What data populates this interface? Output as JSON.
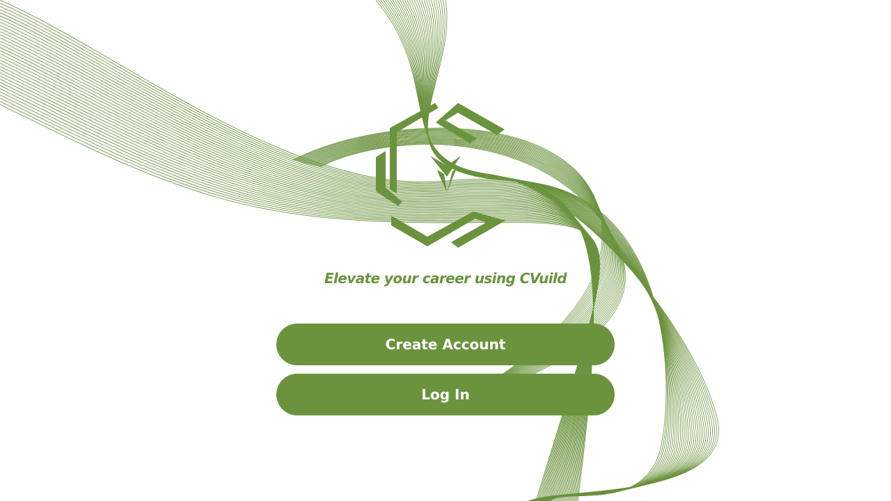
{
  "brand": {
    "name": "CVuild",
    "logo_text": "CVuild",
    "accent_color": "#6b933e",
    "line_color": "#6b933e"
  },
  "tagline": {
    "prefix": "Elevate your career using ",
    "brand": "CVuild"
  },
  "actions": {
    "create_account_label": "Create Account",
    "login_label": "Log In"
  },
  "background": {
    "decoration": "green line-art wave pattern"
  }
}
